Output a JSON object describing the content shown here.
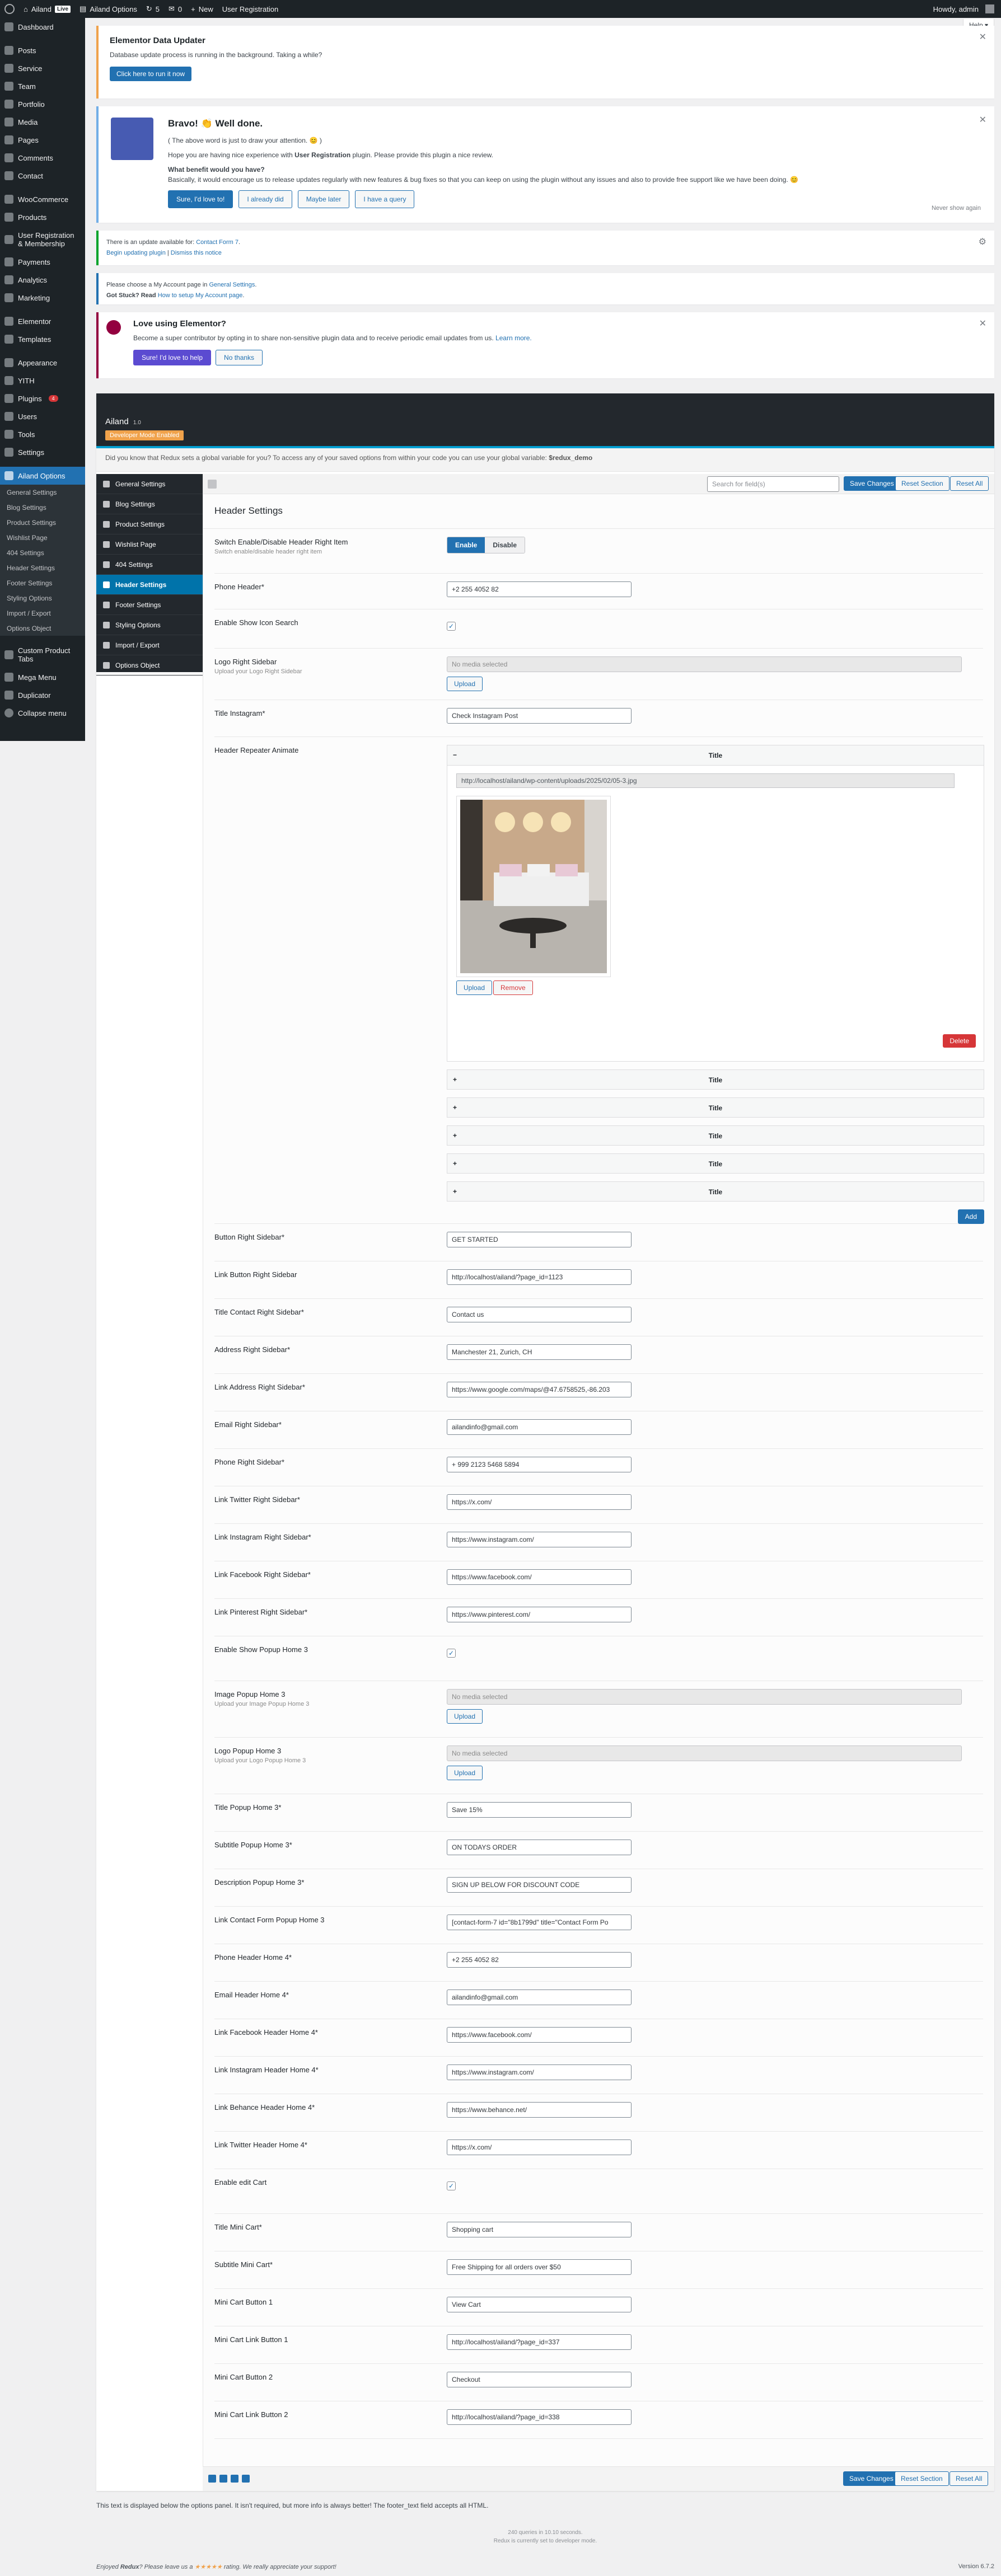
{
  "adminbar": {
    "site": "Ailand",
    "live": "Live",
    "plugin": "Ailand Options",
    "updates": "5",
    "comments": "0",
    "new": "New",
    "registration": "User Registration",
    "howdy": "Howdy, admin"
  },
  "help": "Help",
  "menu": {
    "items": [
      {
        "label": "Dashboard"
      },
      {
        "label": "Posts"
      },
      {
        "label": "Service"
      },
      {
        "label": "Team"
      },
      {
        "label": "Portfolio"
      },
      {
        "label": "Media"
      },
      {
        "label": "Pages"
      },
      {
        "label": "Comments"
      },
      {
        "label": "Contact"
      },
      {
        "label": "WooCommerce"
      },
      {
        "label": "Products"
      },
      {
        "label": "User Registration & Membership"
      },
      {
        "label": "Payments"
      },
      {
        "label": "Analytics"
      },
      {
        "label": "Marketing"
      },
      {
        "label": "Elementor"
      },
      {
        "label": "Templates"
      },
      {
        "label": "Appearance"
      },
      {
        "label": "YITH"
      },
      {
        "label": "Plugins",
        "badge": "4"
      },
      {
        "label": "Users"
      },
      {
        "label": "Tools"
      },
      {
        "label": "Settings"
      },
      {
        "label": "Ailand Options"
      }
    ],
    "submenu": [
      "General Settings",
      "Blog Settings",
      "Product Settings",
      "Wishlist Page",
      "404 Settings",
      "Header Settings",
      "Footer Settings",
      "Styling Options",
      "Import / Export",
      "Options Object"
    ],
    "after": [
      "Custom Product Tabs",
      "Mega Menu",
      "Duplicator",
      "Collapse menu"
    ]
  },
  "notices": {
    "elementor_updater": {
      "title": "Elementor Data Updater",
      "text": "Database update process is running in the background. Taking a while?",
      "button": "Click here to run it now"
    },
    "ur_review": {
      "heading": "Bravo! 👏 Well done.",
      "line1": "( The above word is just to draw your attention. 😊 )",
      "line2_a": "Hope you are having nice experience with ",
      "line2_b": "User Registration",
      "line2_c": " plugin. Please provide this plugin a nice review.",
      "q": "What benefit would you have?",
      "line3": "Basically, it would encourage us to release updates regularly with new features & bug fixes so that you can keep on using the plugin without any issues and also to provide free support like we have been doing. 😊",
      "b1": "Sure, I'd love to!",
      "b2": "I already did",
      "b3": "Maybe later",
      "b4": "I have a query",
      "never": "Never show again"
    },
    "update": {
      "line1": "There is an update available for: ",
      "link1": "Contact Form 7",
      "dot": ".",
      "link2": "Begin updating plugin",
      "sep": " | ",
      "link3": "Dismiss this notice"
    },
    "account": {
      "line1a": "Please choose a My Account page in ",
      "line1link": "General Settings",
      "line1b": ".",
      "line2a": "Got Stuck? Read ",
      "line2link": "How to setup My Account page",
      "line2b": "."
    },
    "love": {
      "title": "Love using Elementor?",
      "text": "Become a super contributor by opting in to share non-sensitive plugin data and to receive periodic email updates from us. ",
      "learn": "Learn more.",
      "b1": "Sure! I'd love to help",
      "b2": "No thanks"
    }
  },
  "redux": {
    "title": "Ailand",
    "version": "1.0",
    "devmode": "Developer Mode Enabled",
    "hint": "Did you know that Redux sets a global variable for you? To access any of your saved options from within your code you can use your global variable: ",
    "var": "$redux_demo",
    "nav": [
      "General Settings",
      "Blog Settings",
      "Product Settings",
      "Wishlist Page",
      "404 Settings",
      "Header Settings",
      "Footer Settings",
      "Styling Options",
      "Import / Export",
      "Options Object"
    ],
    "search_placeholder": "Search for field(s)",
    "save": "Save Changes",
    "reset_section": "Reset Section",
    "reset_all": "Reset All",
    "section_title": "Header Settings",
    "sw": {
      "label": "Switch Enable/Disable Header Right Item",
      "desc": "Switch enable/disable header right item",
      "on": "Enable",
      "off": "Disable"
    },
    "phone": {
      "label": "Phone Header*",
      "value": "+2 255 4052 82"
    },
    "icon_search": {
      "label": "Enable Show Icon Search"
    },
    "logo_right": {
      "label": "Logo Right Sidebar",
      "desc": "Upload your Logo Right Sidebar",
      "value": "No media selected",
      "btn": "Upload"
    },
    "title_instagram": {
      "label": "Title Instagram*",
      "value": "Check Instagram Post"
    },
    "repeater": {
      "label": "Header Repeater Animate",
      "acc_title": "Title",
      "url": "http://localhost/ailand/wp-content/uploads/2025/02/05-3.jpg",
      "upload": "Upload",
      "remove": "Remove",
      "delete": "Delete",
      "add": "Add",
      "collapsed": [
        "Title",
        "Title",
        "Title",
        "Title",
        "Title"
      ]
    },
    "fields": [
      {
        "label": "Button Right Sidebar*",
        "value": "GET STARTED"
      },
      {
        "label": "Link Button Right Sidebar",
        "value": "http://localhost/ailand/?page_id=1123"
      },
      {
        "label": "Title Contact Right Sidebar*",
        "value": "Contact us"
      },
      {
        "label": "Address Right Sidebar*",
        "value": "Manchester 21, Zurich, CH"
      },
      {
        "label": "Link Address Right Sidebar*",
        "value": "https://www.google.com/maps/@47.6758525,-86.203"
      },
      {
        "label": "Email Right Sidebar*",
        "value": "ailandinfo@gmail.com"
      },
      {
        "label": "Phone Right Sidebar*",
        "value": "+ 999 2123 5468 5894"
      },
      {
        "label": "Link Twitter Right Sidebar*",
        "value": "https://x.com/"
      },
      {
        "label": "Link Instagram Right Sidebar*",
        "value": "https://www.instagram.com/"
      },
      {
        "label": "Link Facebook Right Sidebar*",
        "value": "https://www.facebook.com/"
      },
      {
        "label": "Link Pinterest Right Sidebar*",
        "value": "https://www.pinterest.com/"
      }
    ],
    "popup_enable": {
      "label": "Enable Show Popup Home 3"
    },
    "image_popup": {
      "label": "Image Popup Home 3",
      "desc": "Upload your Image Popup Home 3",
      "value": "No media selected",
      "btn": "Upload"
    },
    "logo_popup": {
      "label": "Logo Popup Home 3",
      "desc": "Upload your Logo Popup Home 3",
      "value": "No media selected",
      "btn": "Upload"
    },
    "fields2": [
      {
        "label": "Title Popup Home 3*",
        "value": "Save 15%"
      },
      {
        "label": "Subtitle Popup Home 3*",
        "value": "ON TODAYS ORDER"
      },
      {
        "label": "Description Popup Home 3*",
        "value": "SIGN UP BELOW FOR DISCOUNT CODE"
      },
      {
        "label": "Link Contact Form Popup Home 3",
        "value": "[contact-form-7 id=\"8b1799d\" title=\"Contact Form Po"
      },
      {
        "label": "Phone Header Home 4*",
        "value": "+2 255 4052 82"
      },
      {
        "label": "Email Header Home 4*",
        "value": "ailandinfo@gmail.com"
      },
      {
        "label": "Link Facebook Header Home 4*",
        "value": "https://www.facebook.com/"
      },
      {
        "label": "Link Instagram Header Home 4*",
        "value": "https://www.instagram.com/"
      },
      {
        "label": "Link Behance Header Home 4*",
        "value": "https://www.behance.net/"
      },
      {
        "label": "Link Twitter Header Home 4*",
        "value": "https://x.com/"
      }
    ],
    "cart_enable": {
      "label": "Enable edit Cart"
    },
    "fields3": [
      {
        "label": "Title Mini Cart*",
        "value": "Shopping cart"
      },
      {
        "label": "Subtitle Mini Cart*",
        "value": "Free Shipping for all orders over $50"
      },
      {
        "label": "Mini Cart Button 1",
        "value": "View Cart"
      },
      {
        "label": "Mini Cart Link Button 1",
        "value": "http://localhost/ailand/?page_id=337"
      },
      {
        "label": "Mini Cart Button 2",
        "value": "Checkout"
      },
      {
        "label": "Mini Cart Link Button 2",
        "value": "http://localhost/ailand/?page_id=338"
      }
    ],
    "footer_text": "This text is displayed below the options panel. It isn't required, but more info is always better! The footer_text field accepts all HTML.",
    "queries": "240 queries in 10.10 seconds.",
    "devnote": "Redux is currently set to developer mode."
  },
  "footer": {
    "enjoyed_a": "Enjoyed ",
    "redux": "Redux",
    "enjoyed_b": "? Please leave us a ",
    "stars": "★★★★★",
    "enjoyed_c": " rating. We really appreciate your support!",
    "version": "Version 6.7.2"
  },
  "colors": {
    "accent": "#2271b1",
    "adminbar": "#1d2327",
    "delete": "#d63638",
    "devmode": "#f0a24b"
  }
}
